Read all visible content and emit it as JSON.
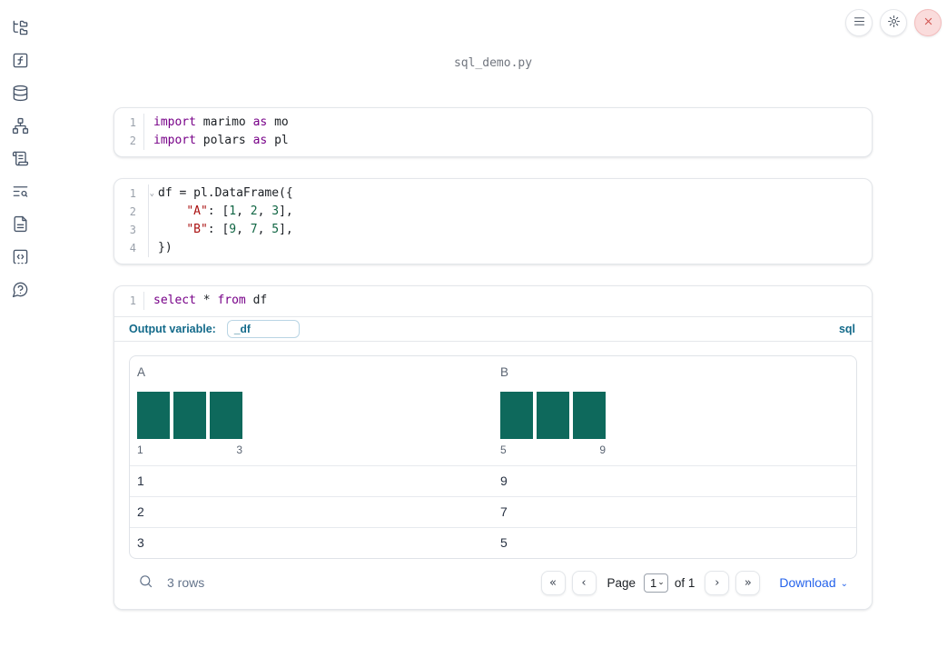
{
  "app": {
    "title": "sql_demo.py"
  },
  "sidebar": {
    "items": [
      {
        "name": "file-explorer"
      },
      {
        "name": "variables"
      },
      {
        "name": "datasources"
      },
      {
        "name": "dependency-graph"
      },
      {
        "name": "scratchpad"
      },
      {
        "name": "logs"
      },
      {
        "name": "documentation"
      },
      {
        "name": "snippets"
      },
      {
        "name": "help"
      }
    ]
  },
  "topbar": {
    "buttons": [
      {
        "name": "menu"
      },
      {
        "name": "settings"
      },
      {
        "name": "shutdown"
      }
    ]
  },
  "icons": {
    "first_page": "«",
    "prev_page": "‹",
    "next_page": "›",
    "last_page": "»",
    "dropdown_chevron": "⌄",
    "fold_chevron": "⌄"
  },
  "cells": [
    {
      "lines": [
        {
          "num": "1",
          "tokens": [
            "import",
            " marimo ",
            "as",
            " mo"
          ]
        },
        {
          "num": "2",
          "tokens": [
            "import",
            " polars ",
            "as",
            " pl"
          ]
        }
      ]
    },
    {
      "lines": [
        {
          "num": "1",
          "tokens": [
            "df = pl.DataFrame({"
          ]
        },
        {
          "num": "2",
          "tokens": [
            "    ",
            "\"A\"",
            ": [",
            "1",
            ", ",
            "2",
            ", ",
            "3",
            "],"
          ]
        },
        {
          "num": "3",
          "tokens": [
            "    ",
            "\"B\"",
            ": [",
            "9",
            ", ",
            "7",
            ", ",
            "5",
            "],"
          ]
        },
        {
          "num": "4",
          "tokens": [
            "})"
          ]
        }
      ]
    },
    {
      "lines": [
        {
          "num": "1",
          "tokens": [
            "select",
            " * ",
            "from",
            " df"
          ]
        }
      ]
    }
  ],
  "sql": {
    "output_variable_label": "Output variable:",
    "output_variable_value": "_df",
    "language": "sql"
  },
  "table": {
    "columns": [
      {
        "name": "A",
        "hist_min": "1",
        "hist_max": "3",
        "bars": [
          1,
          1,
          1
        ]
      },
      {
        "name": "B",
        "hist_min": "5",
        "hist_max": "9",
        "bars": [
          1,
          1,
          1
        ]
      }
    ],
    "rows": [
      [
        "1",
        "9"
      ],
      [
        "2",
        "7"
      ],
      [
        "3",
        "5"
      ]
    ],
    "footer": {
      "row_count": "3 rows",
      "page_label": "Page",
      "page_value": "1",
      "page_total": "of 1",
      "download_label": "Download"
    }
  },
  "colors": {
    "histogram_teal": "#0e695c",
    "link_blue": "#2563eb",
    "sql_blue": "#136a8a",
    "keyword_purple": "#770088",
    "string_red": "#aa1111",
    "number_green": "#116644"
  }
}
